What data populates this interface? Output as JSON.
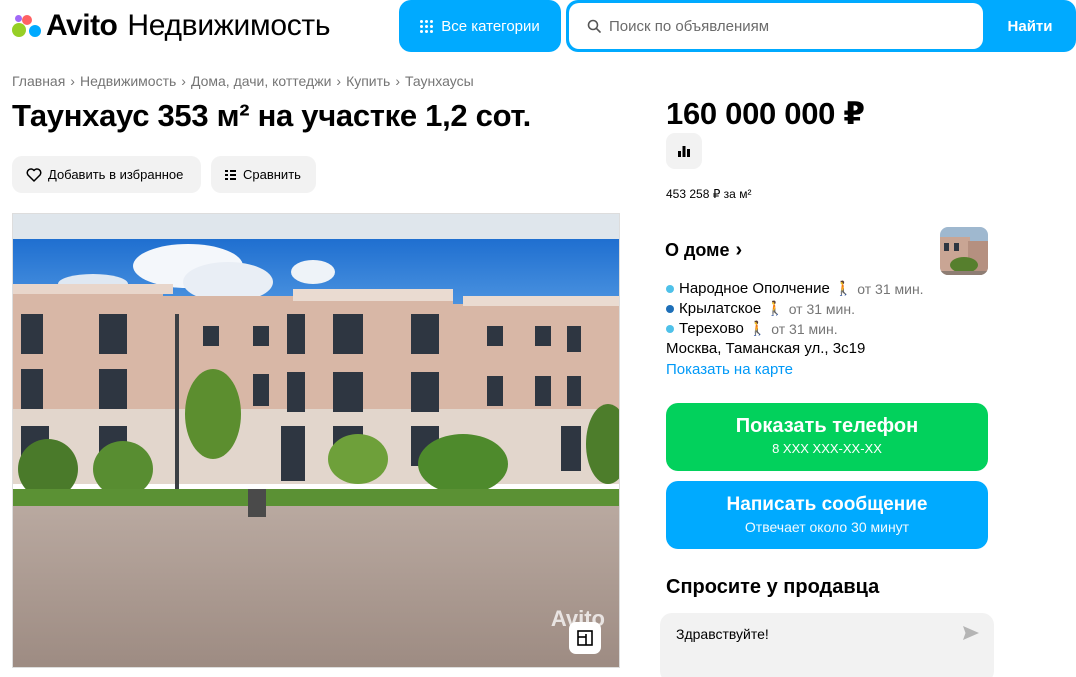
{
  "header": {
    "brand": "Avito",
    "section": "Недвижимость",
    "categories_label": "Все категории",
    "search_placeholder": "Поиск по объявлениям",
    "search_button": "Найти",
    "logo_colors": [
      "#97cf26",
      "#ff6163",
      "#0af",
      "#a169f7"
    ]
  },
  "breadcrumb": [
    "Главная",
    "Недвижимость",
    "Дома, дачи, коттеджи",
    "Купить",
    "Таунхаусы"
  ],
  "listing": {
    "title": "Таунхаус 353 м² на участке 1,2 сот.",
    "favorite_label": "Добавить в избранное",
    "compare_label": "Сравнить",
    "watermark": "Avito"
  },
  "price": {
    "value": "160 000 000 ₽",
    "per_m2": "453 258 ₽ за м²"
  },
  "house": {
    "about_label": "О доме",
    "metro": [
      {
        "name": "Народное Ополчение",
        "time": "от 31 мин.",
        "color": "#4fc1e9"
      },
      {
        "name": "Крылатское",
        "time": "от 31 мин.",
        "color": "#1d6fb8"
      },
      {
        "name": "Терехово",
        "time": "от 31 мин.",
        "color": "#4fc1e9"
      }
    ],
    "address": "Москва, Таманская ул., 3с19",
    "map_link": "Показать на карте"
  },
  "contact": {
    "phone_label": "Показать телефон",
    "phone_masked": "8 XXX XXX-XX-XX",
    "message_label": "Написать сообщение",
    "response_time": "Отвечает около 30 минут",
    "ask_title": "Спросите у продавца",
    "ask_text": "Здравствуйте!"
  },
  "colors": {
    "accent": "#00aaff",
    "green": "#02d15c",
    "link": "#0099f7"
  }
}
